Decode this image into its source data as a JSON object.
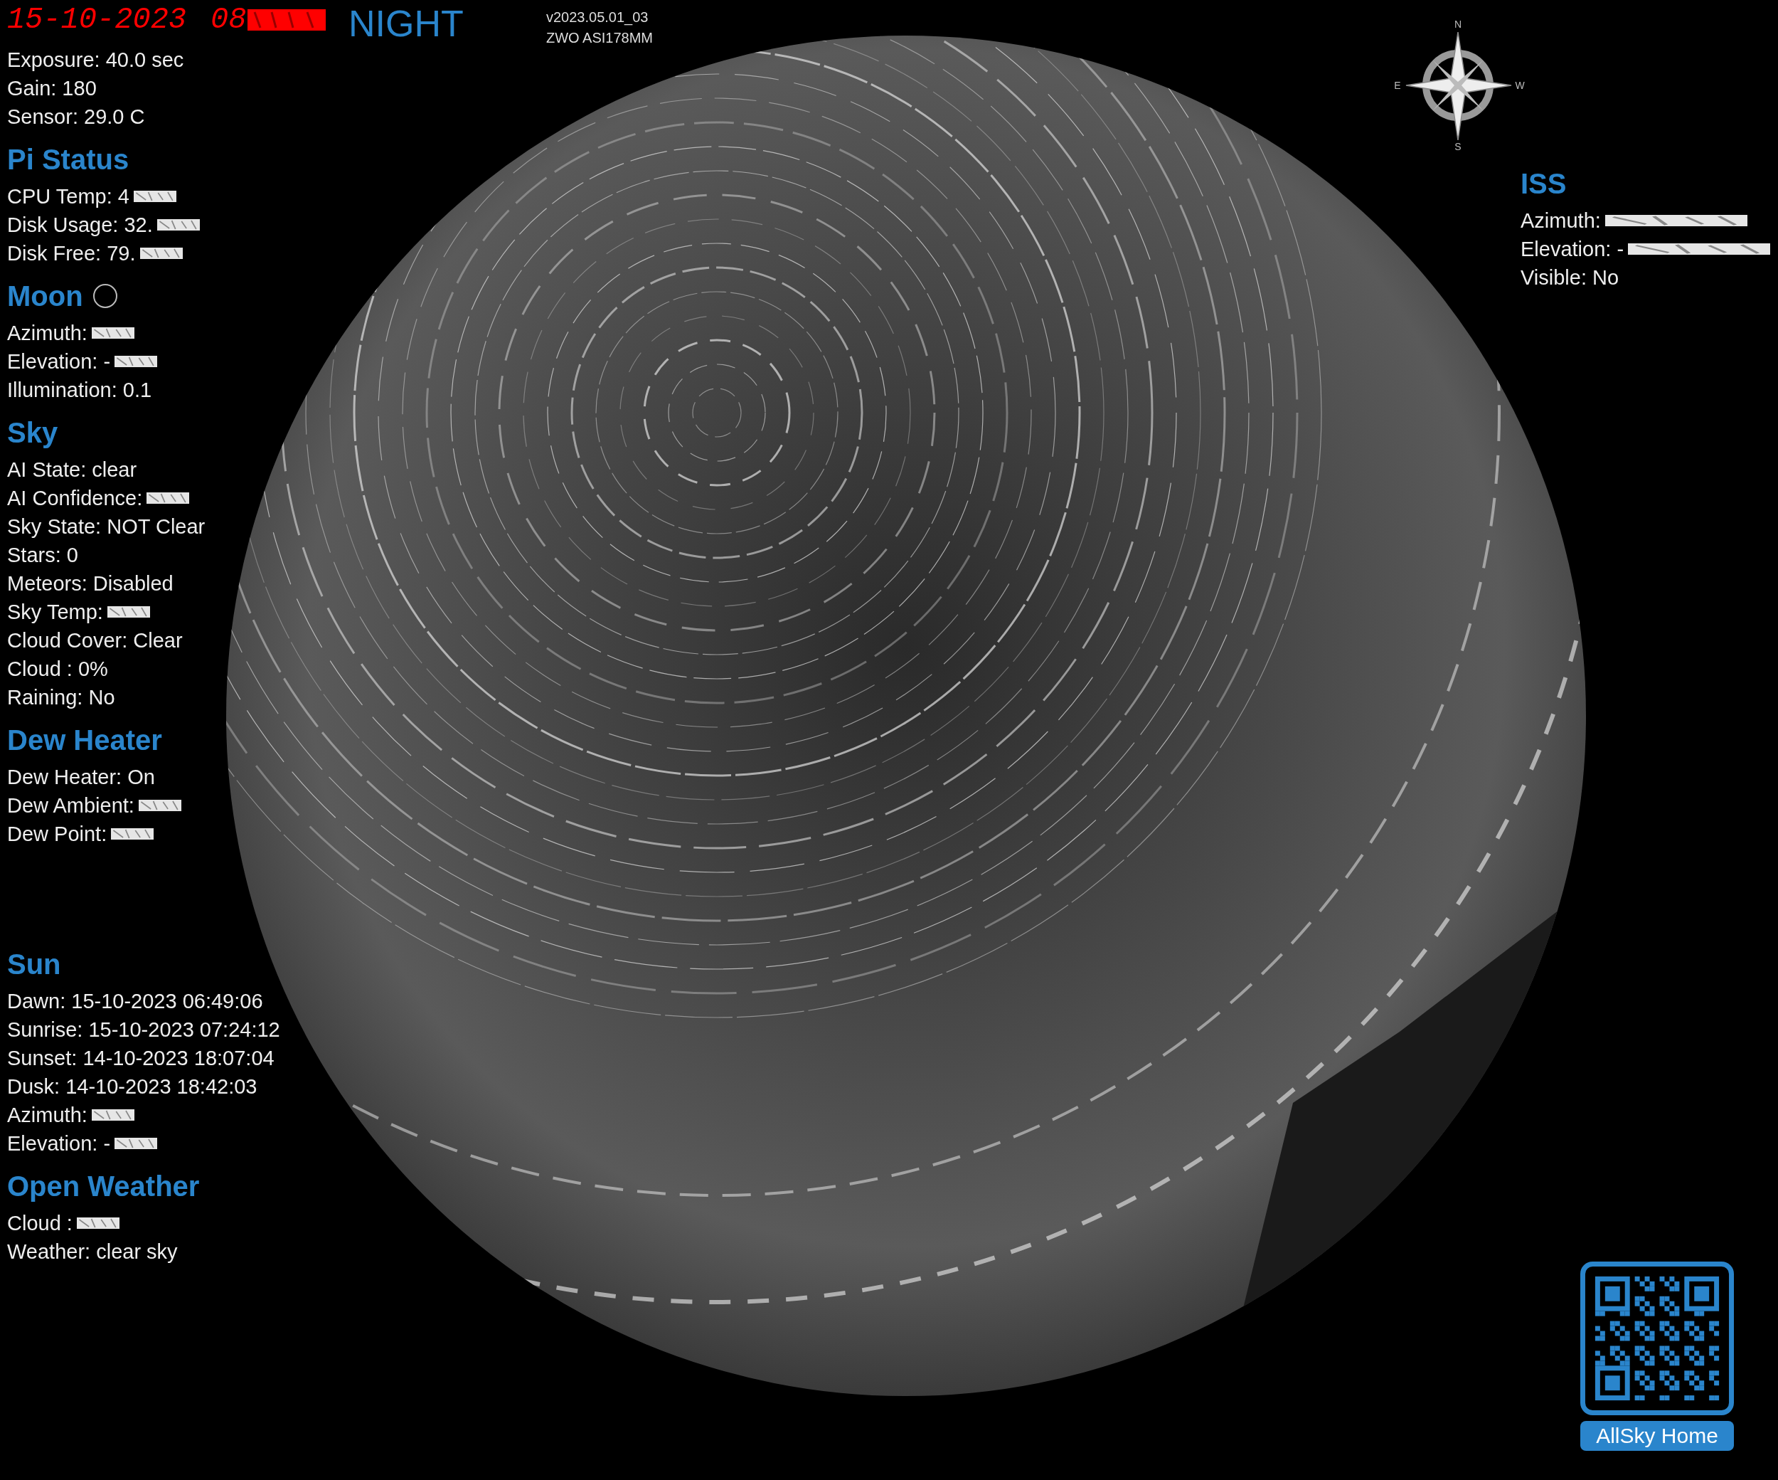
{
  "header": {
    "date": "15-10-2023",
    "time": "08",
    "time_garbled": true,
    "mode": "NIGHT",
    "version": "v2023.05.01_03",
    "camera": "ZWO ASI178MM"
  },
  "compass": {
    "north": "N",
    "east": "E",
    "west": "W",
    "south": "S"
  },
  "camera_lines": [
    {
      "text": "Exposure: 40.0 sec",
      "garbled": false
    },
    {
      "text": "Gain: 180",
      "garbled": false
    },
    {
      "text": "Sensor: 29.0 C",
      "garbled": false
    }
  ],
  "upper_sections": [
    {
      "title": "Pi Status",
      "phase_icon": false,
      "items": [
        {
          "text": "CPU Temp: 4",
          "garbled": true
        },
        {
          "text": "Disk Usage: 32.",
          "garbled": true
        },
        {
          "text": "Disk Free: 79.",
          "garbled": true
        }
      ]
    },
    {
      "title": "Moon",
      "phase_icon": true,
      "items": [
        {
          "text": "Azimuth:",
          "garbled": true
        },
        {
          "text": "Elevation: -",
          "garbled": true
        },
        {
          "text": "Illumination: 0.1",
          "garbled": false
        }
      ]
    },
    {
      "title": "Sky",
      "phase_icon": false,
      "items": [
        {
          "text": "AI State: clear",
          "garbled": false
        },
        {
          "text": "AI Confidence:",
          "garbled": true
        },
        {
          "text": "Sky State: NOT Clear",
          "garbled": false
        },
        {
          "text": "Stars: 0",
          "garbled": false
        },
        {
          "text": "Meteors: Disabled",
          "garbled": false
        },
        {
          "text": "Sky Temp:",
          "garbled": true
        },
        {
          "text": "Cloud Cover: Clear",
          "garbled": false
        },
        {
          "text": "Cloud : 0%",
          "garbled": false
        },
        {
          "text": "Raining: No",
          "garbled": false
        }
      ]
    },
    {
      "title": "Dew Heater",
      "phase_icon": false,
      "items": [
        {
          "text": "Dew Heater: On",
          "garbled": false
        },
        {
          "text": "Dew Ambient:",
          "garbled": true
        },
        {
          "text": "Dew Point:",
          "garbled": true
        }
      ]
    }
  ],
  "lower_sections": [
    {
      "title": "Sun",
      "phase_icon": false,
      "items": [
        {
          "text": "Dawn: 15-10-2023 06:49:06",
          "garbled": false
        },
        {
          "text": "Sunrise: 15-10-2023 07:24:12",
          "garbled": false
        },
        {
          "text": "Sunset: 14-10-2023 18:07:04",
          "garbled": false
        },
        {
          "text": "Dusk: 14-10-2023 18:42:03",
          "garbled": false
        },
        {
          "text": "Azimuth:",
          "garbled": true
        },
        {
          "text": "Elevation: -",
          "garbled": true
        }
      ]
    },
    {
      "title": "Open Weather",
      "phase_icon": false,
      "items": [
        {
          "text": "Cloud :",
          "garbled": true
        },
        {
          "text": "Weather: clear sky",
          "garbled": false
        }
      ]
    }
  ],
  "iss": {
    "title": "ISS",
    "items": [
      {
        "text": "Azimuth:",
        "garbled": true
      },
      {
        "text": "Elevation: -",
        "garbled": true
      },
      {
        "text": "Visible: No",
        "garbled": false
      }
    ]
  },
  "qr": {
    "label": "AllSky Home"
  }
}
